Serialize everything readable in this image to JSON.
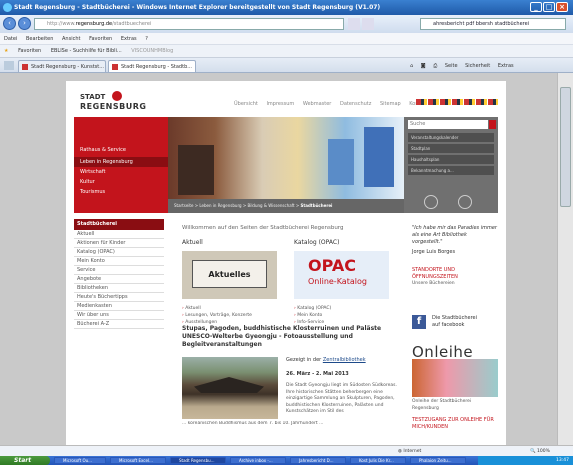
{
  "window": {
    "title": "Stadt Regensburg - Stadtbücherei - Windows Internet Explorer bereitgestellt von Stadt Regensburg (V1.07)"
  },
  "addressbar": {
    "url_pre": "http://www.",
    "url_domain": "regensburg.de",
    "url_post": "/stadtbuecherei",
    "search_text": "ahresbericht pdf bbersh stadtbücherei"
  },
  "menu": {
    "items": [
      "Datei",
      "Bearbeiten",
      "Ansicht",
      "Favoriten",
      "Extras",
      "?"
    ]
  },
  "favorites": {
    "label": "Favoriten",
    "items": [
      "EBLISe - Suchhilfe für Bibli...",
      "VISCOUNHMBlog"
    ]
  },
  "tabs": [
    {
      "label": "Stadt Regensburg - Kunstst..."
    },
    {
      "label": "Stadt Regensburg - Stadtb..."
    }
  ],
  "commandbar": {
    "items": [
      "Seite",
      "Sicherheit",
      "Extras"
    ]
  },
  "site": {
    "logo_line1": "STADT",
    "logo_line2": "REGENSBURG",
    "topnav": [
      "Übersicht",
      "Impressum",
      "Webmaster",
      "Datenschutz",
      "Sitemap",
      "Kontakt"
    ],
    "left_menu": [
      "Rathaus & Service",
      "Leben in Regensburg",
      "Wirtschaft",
      "Kultur",
      "Tourismus"
    ],
    "left_menu_active": "Leben in Regensburg",
    "breadcrumb": "Startseite > Leben in Regensburg > Bildung & Wissenschaft > ",
    "breadcrumb_current": "Stadtbücherei",
    "search_placeholder": "Suche",
    "right_links": [
      "Veranstaltungskalender",
      "Stadtplan",
      "Haushaltsplan",
      "Bekanntmachung a..."
    ],
    "side_nav_head": "Stadtbücherei",
    "side_nav": [
      "Aktuell",
      "Aktionen für Kinder",
      "Katalog (OPAC)",
      "Mein Konto",
      "Service",
      "Angebote",
      "Bibliotheken",
      "Heute's Büchertipps",
      "Medienkasten",
      "Wir über uns",
      "Bücherei A-Z"
    ],
    "welcome": "Willkommen auf den Seiten der Stadtbücherei Regensburg",
    "aktuell_title": "Aktuell",
    "aktuell_img": "Aktuelles",
    "aktuell_links": [
      "Aktuell",
      "Lesungen, Vorträge, Konzerte",
      "Ausstellungen"
    ],
    "katalog_title": "Katalog (OPAC)",
    "opac_big": "OPAC",
    "opac_small": "Online-Katalog",
    "katalog_links": [
      "Katalog (OPAC)",
      "Mein Konto",
      "Info-Service"
    ],
    "article_title": "Stupas, Pagoden, buddhistische Klosterruinen und Paläste UNESCO-Welterbe Gyeongju - Fotoausstellung und Begleitveranstaltungen",
    "datum_pre": "Gezeigt in der ",
    "datum_link": "Zentralbibliothek",
    "dates": "26. März - 2. Mai 2013",
    "article_text": "Die Stadt Gyeongju liegt im Südosten Südkoreas. Ihre historischen Stätten beherbergen eine einzigartige Sammlung an Skulpturen, Pagoden, buddhistischen Klosterruinen, Palästen und Kunstschätzen im Stil des",
    "article_trunc": "... koreanischen Buddhismus aus dem 7. bis 10. Jahrhundert ...",
    "quote": "\"Ich habe mir das Paradies immer als eine Art Bibliothek vorgestellt.\"",
    "quote_author": "Jorge Luis Borges",
    "standorte": "STANDORTE UND ÖFFNUNGSZEITEN",
    "unsere": "Unsere Büchereien",
    "fb_text1": "Die Stadtbücherei",
    "fb_text2": "auf facebook",
    "onleihe": "Onleihe",
    "onleihe_link": "Onleihe der Stadtbücherei Regensburg",
    "testzugang": "TESTZUGANG ZUR ONLEIHE FÜR MICH/KUNDEN"
  },
  "statusbar": {
    "internet": "Internet",
    "zoom": "100%"
  },
  "taskbar": {
    "start": "Start",
    "tasks": [
      "Microsoft Ou...",
      "Microsoft Excel...",
      "Stadt Regensbu...",
      "Archive inbox -...",
      "Jahresbericht D...",
      "Kost Julis Die Kr...",
      "Phalaion Zeitu..."
    ],
    "clock": "13:47"
  },
  "colors": {
    "accent_red": "#c3141c",
    "titlebar_blue": "#2c6cc4",
    "facebook_blue": "#3b5998"
  }
}
